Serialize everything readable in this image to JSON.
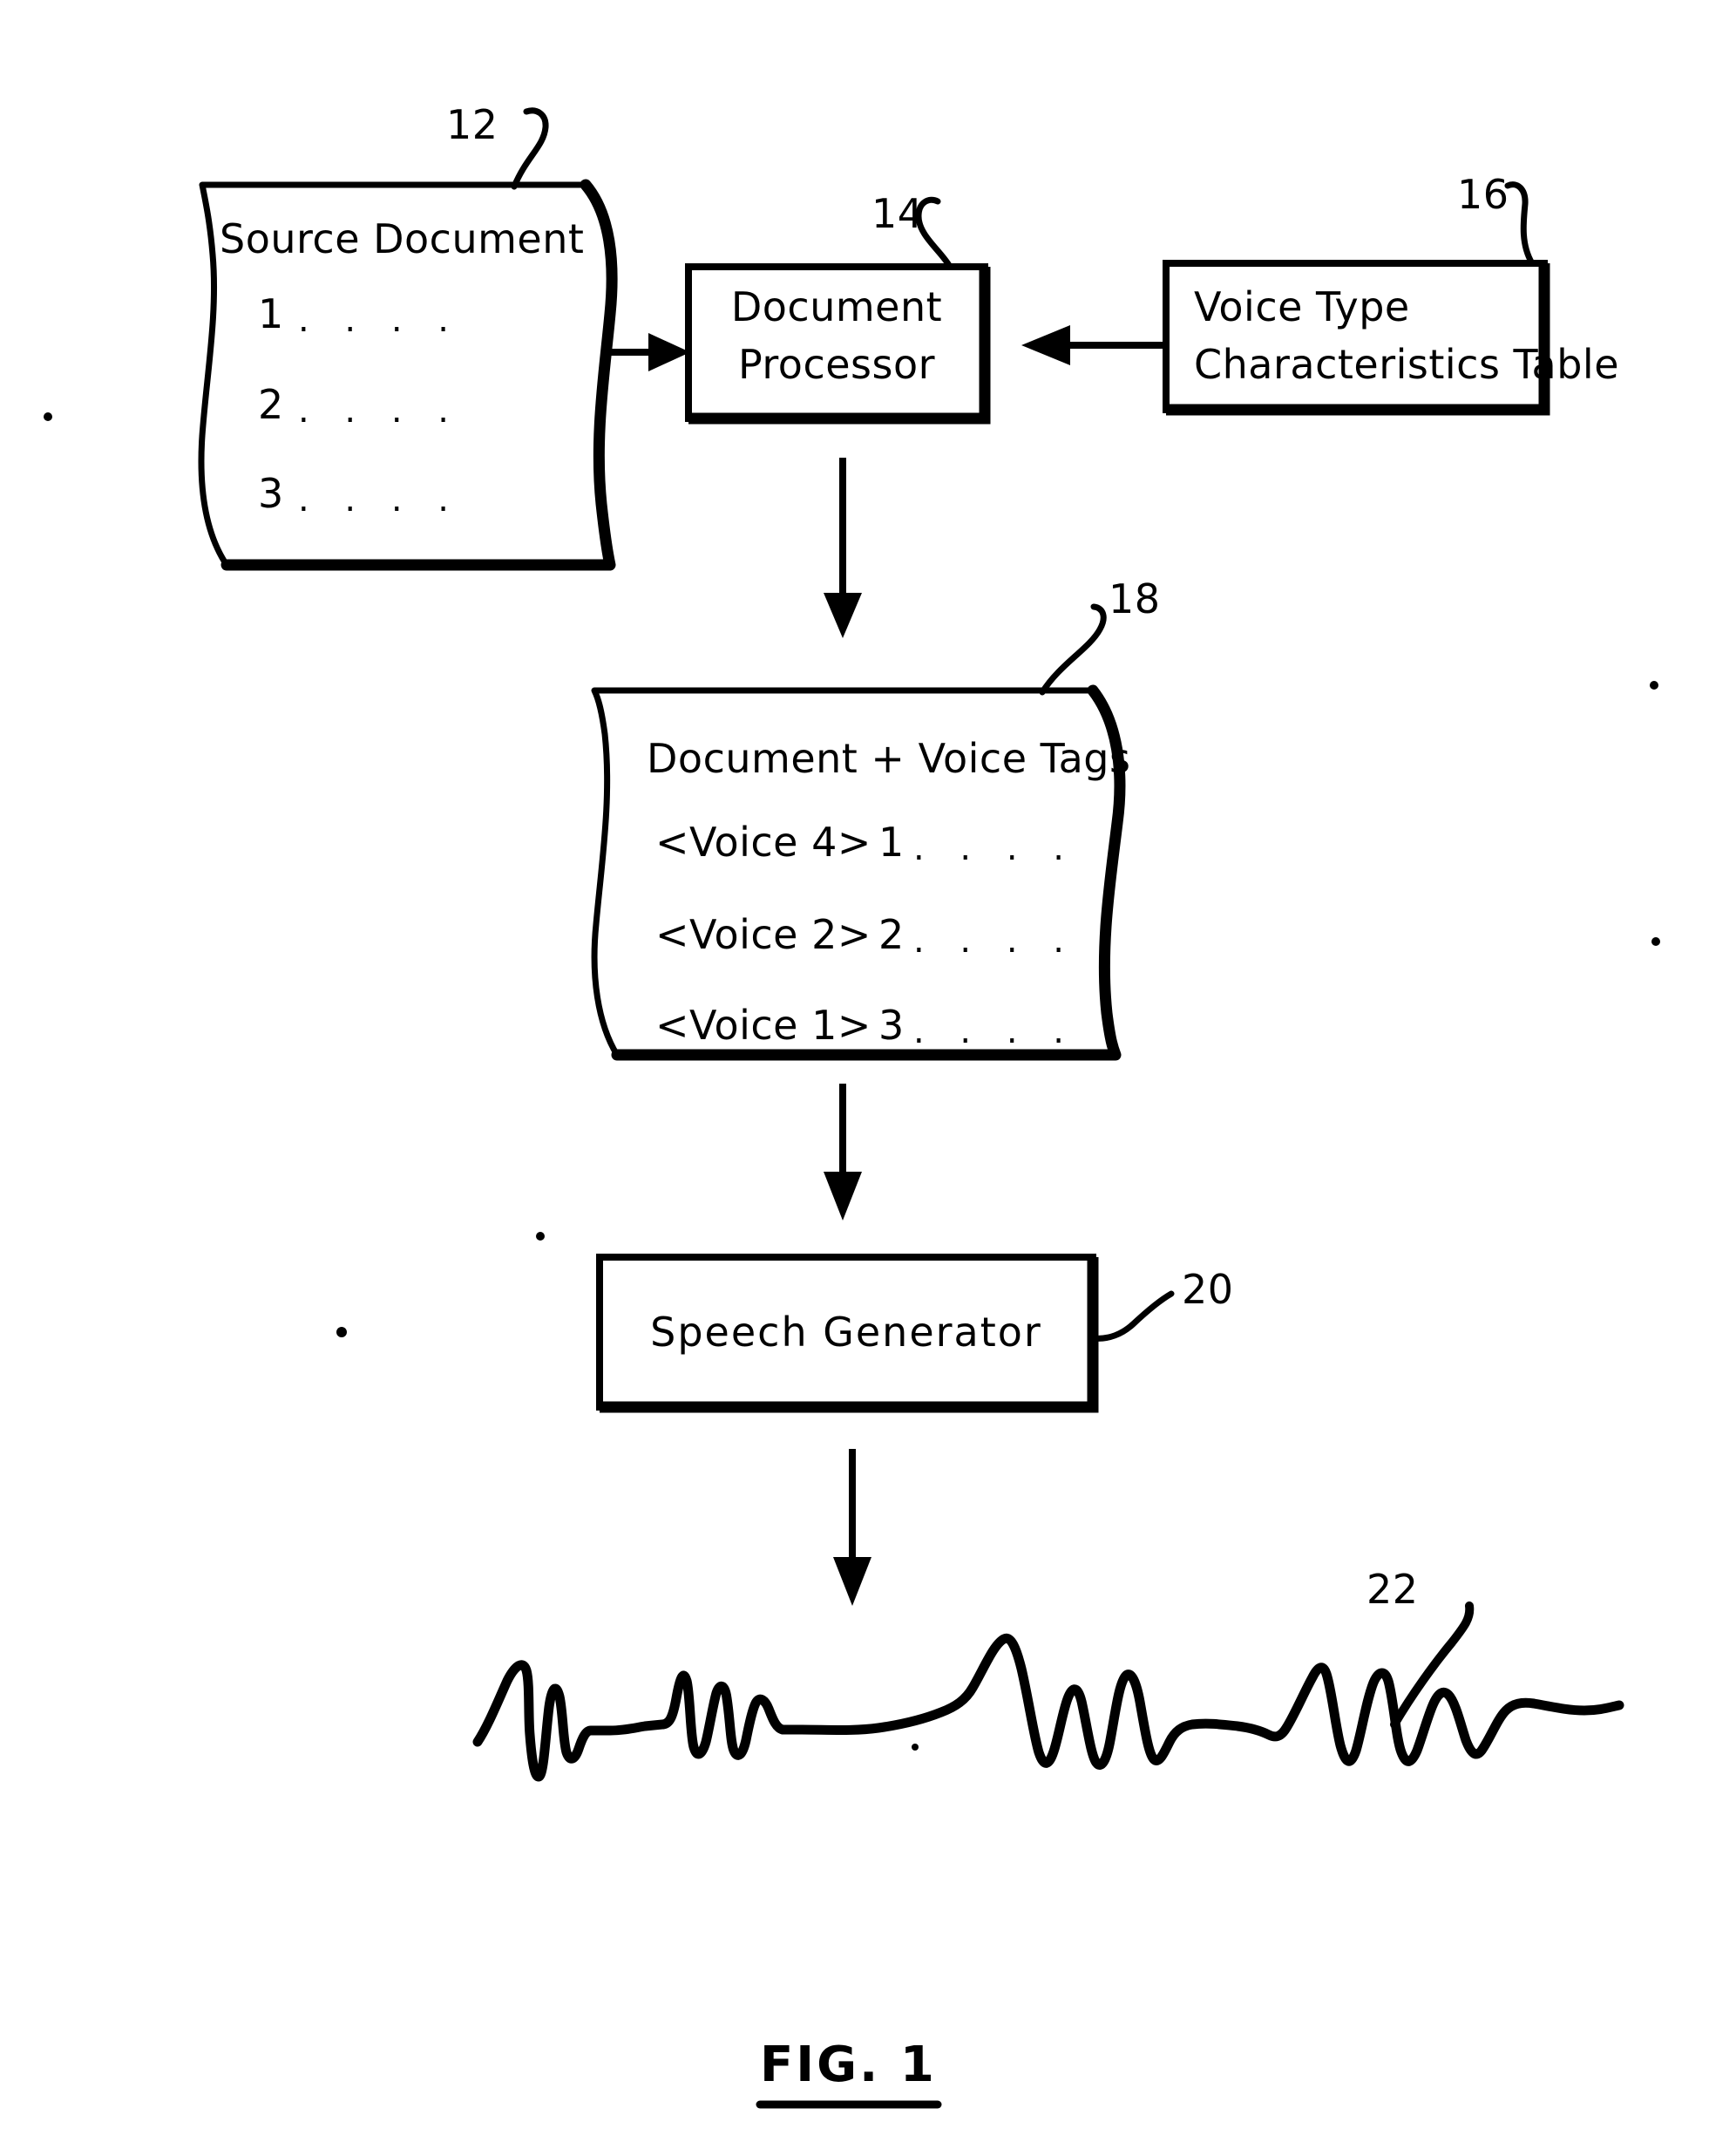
{
  "figure": {
    "caption": "FIG. 1",
    "type": "patent-flow-diagram"
  },
  "nodes": {
    "source_document": {
      "ref": "12",
      "title": "Source Document",
      "lines": [
        {
          "num": "1",
          "dots": ". . . ."
        },
        {
          "num": "2",
          "dots": ". . . ."
        },
        {
          "num": "3",
          "dots": ". . . ."
        }
      ],
      "shape": "scroll"
    },
    "document_processor": {
      "ref": "14",
      "line1": "Document",
      "line2": "Processor",
      "shape": "rect"
    },
    "voice_type_table": {
      "ref": "16",
      "line1": "Voice Type",
      "line2": "Characteristics Table",
      "shape": "rect"
    },
    "document_voice_tags": {
      "ref": "18",
      "title": "Document + Voice Tags",
      "lines": [
        {
          "tag": "<Voice 4>",
          "num": "1",
          "dots": ". . . ."
        },
        {
          "tag": "<Voice 2>",
          "num": "2",
          "dots": ". . . ."
        },
        {
          "tag": "<Voice 1>",
          "num": "3",
          "dots": ". . . ."
        }
      ],
      "shape": "scroll"
    },
    "speech_generator": {
      "ref": "20",
      "title": "Speech Generator",
      "shape": "rect"
    },
    "speech_waveform": {
      "ref": "22",
      "title": "speech waveform",
      "shape": "waveform"
    }
  },
  "connectors": [
    {
      "name": "source-to-processor",
      "from": "source_document",
      "to": "document_processor",
      "direction": "right"
    },
    {
      "name": "table-to-processor",
      "from": "voice_type_table",
      "to": "document_processor",
      "direction": "left"
    },
    {
      "name": "processor-to-tagged-doc",
      "from": "document_processor",
      "to": "document_voice_tags",
      "direction": "down"
    },
    {
      "name": "tagged-doc-to-generator",
      "from": "document_voice_tags",
      "to": "speech_generator",
      "direction": "down"
    },
    {
      "name": "generator-to-waveform",
      "from": "speech_generator",
      "to": "speech_waveform",
      "direction": "down"
    }
  ],
  "colors": {
    "ink": "#000000",
    "paper": "#ffffff"
  }
}
